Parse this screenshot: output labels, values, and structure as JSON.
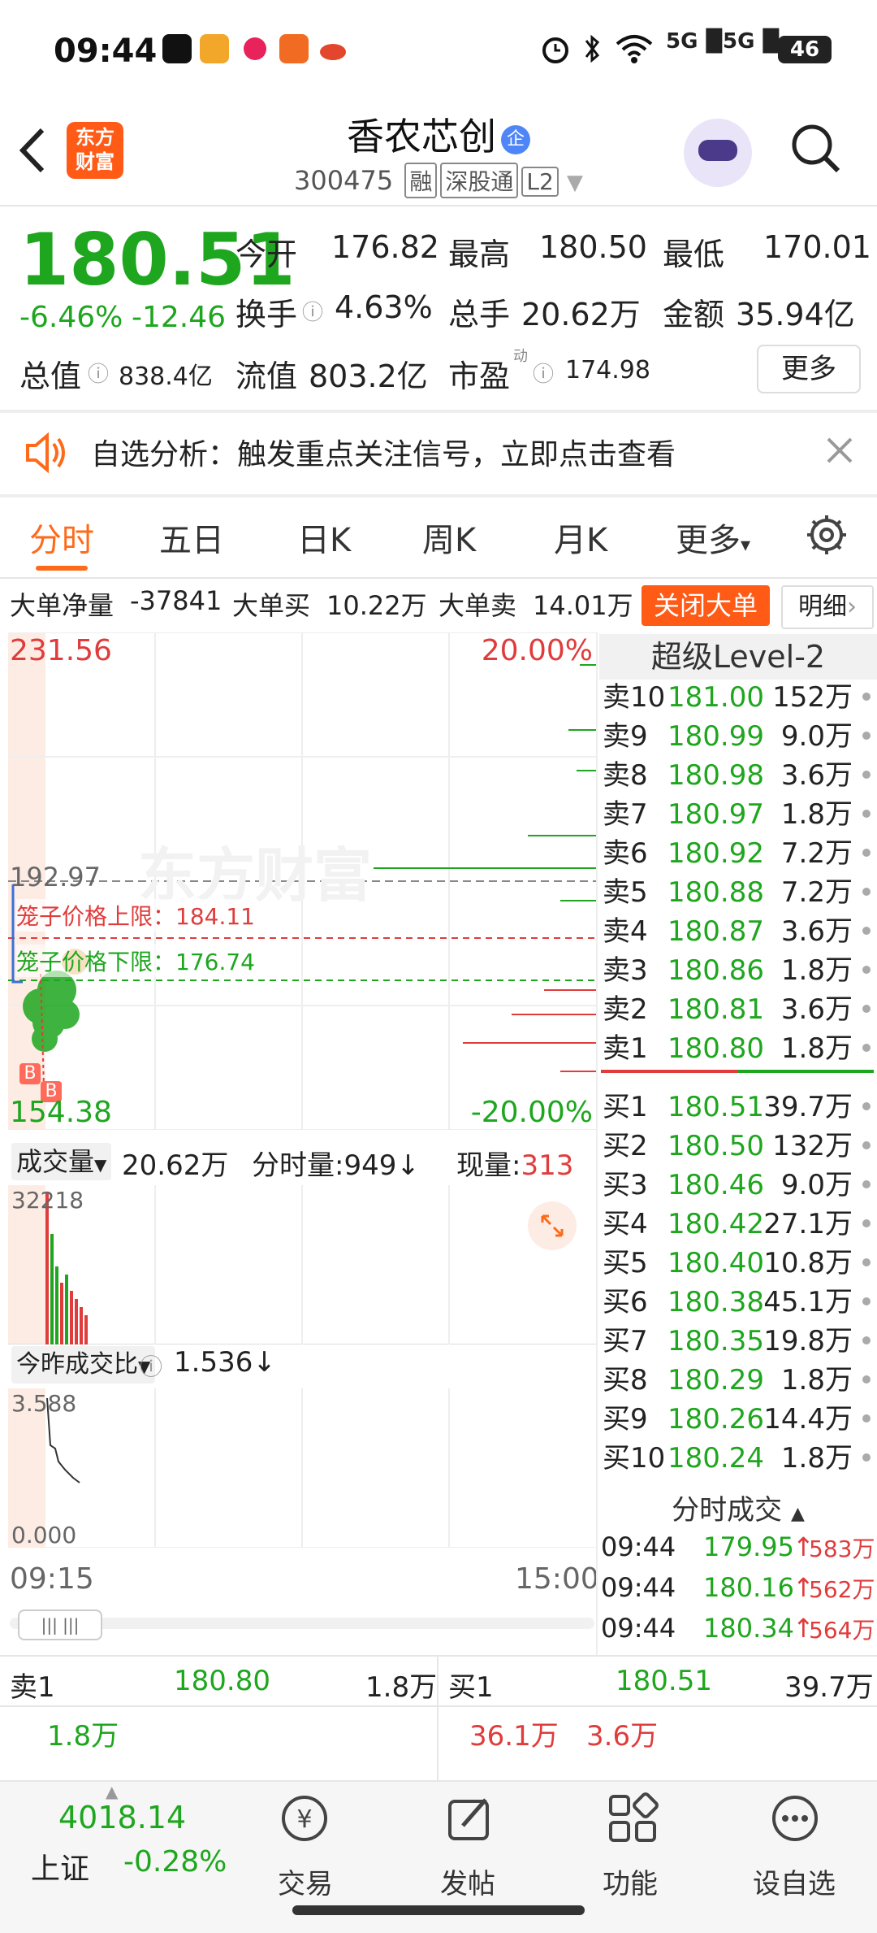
{
  "status_bar": {
    "time": "09:44",
    "network": "5G 5G",
    "battery": "46"
  },
  "header": {
    "back": "<",
    "logo_text": "东方财富",
    "stock_name": "香农芯创",
    "name_badge": "企",
    "code": "300475",
    "tags": [
      "融",
      "深股通",
      "L2"
    ]
  },
  "quote": {
    "price": "180.51",
    "change_pct": "-6.46%",
    "change": "-12.46",
    "open_label": "今开",
    "open": "176.82",
    "high_label": "最高",
    "high": "180.50",
    "low_label": "最低",
    "low": "170.01",
    "turnover_label": "换手",
    "turnover": "4.63%",
    "total_hands_label": "总手",
    "total_hands": "20.62万",
    "amount_label": "金额",
    "amount": "35.94亿",
    "mktcap_label": "总值",
    "mktcap": "838.4亿",
    "float_label": "流值",
    "float_val": "803.2亿",
    "pe_label": "市盈",
    "pe_sup": "动",
    "pe": "174.98",
    "more": "更多"
  },
  "banner": {
    "text": "自选分析：触发重点关注信号，立即点击查看"
  },
  "tabs": [
    "分时",
    "五日",
    "日K",
    "周K",
    "月K",
    "更多"
  ],
  "big_order": {
    "net_label": "大单净量",
    "net": "-37841",
    "buy_label": "大单买",
    "buy": "10.22万",
    "sell_label": "大单卖",
    "sell": "14.01万",
    "close_btn": "关闭大单",
    "detail_btn": "明细"
  },
  "chart": {
    "top_price": "231.56",
    "top_pct": "20.00%",
    "mid_price": "192.97",
    "cage_upper": "笼子价格上限：184.11",
    "cage_lower": "笼子价格下限：176.74",
    "bottom_price": "154.38",
    "bottom_pct": "-20.00%",
    "watermark": "东方财富",
    "markers": [
      "B",
      "B"
    ],
    "volume_label": "成交量",
    "volume": "20.62万",
    "tick_vol_label": "分时量:",
    "tick_vol": "949↓",
    "now_vol_label": "现量:",
    "now_vol": "313",
    "vol_max": "32218",
    "ratio_label": "今昨成交比",
    "ratio": "1.536↓",
    "ratio_max": "3.588",
    "ratio_min": "0.000",
    "time_start": "09:15",
    "time_end": "15:00"
  },
  "order_book": {
    "title": "超级Level-2",
    "sells": [
      {
        "label": "卖10",
        "price": "181.00",
        "vol": "152万"
      },
      {
        "label": "卖9",
        "price": "180.99",
        "vol": "9.0万"
      },
      {
        "label": "卖8",
        "price": "180.98",
        "vol": "3.6万"
      },
      {
        "label": "卖7",
        "price": "180.97",
        "vol": "1.8万"
      },
      {
        "label": "卖6",
        "price": "180.92",
        "vol": "7.2万"
      },
      {
        "label": "卖5",
        "price": "180.88",
        "vol": "7.2万"
      },
      {
        "label": "卖4",
        "price": "180.87",
        "vol": "3.6万"
      },
      {
        "label": "卖3",
        "price": "180.86",
        "vol": "1.8万"
      },
      {
        "label": "卖2",
        "price": "180.81",
        "vol": "3.6万"
      },
      {
        "label": "卖1",
        "price": "180.80",
        "vol": "1.8万"
      }
    ],
    "buys": [
      {
        "label": "买1",
        "price": "180.51",
        "vol": "39.7万"
      },
      {
        "label": "买2",
        "price": "180.50",
        "vol": "132万"
      },
      {
        "label": "买3",
        "price": "180.46",
        "vol": "9.0万"
      },
      {
        "label": "买4",
        "price": "180.42",
        "vol": "27.1万"
      },
      {
        "label": "买5",
        "price": "180.40",
        "vol": "10.8万"
      },
      {
        "label": "买6",
        "price": "180.38",
        "vol": "45.1万"
      },
      {
        "label": "买7",
        "price": "180.35",
        "vol": "19.8万"
      },
      {
        "label": "买8",
        "price": "180.29",
        "vol": "1.8万"
      },
      {
        "label": "买9",
        "price": "180.26",
        "vol": "14.4万"
      },
      {
        "label": "买10",
        "price": "180.24",
        "vol": "1.8万"
      }
    ]
  },
  "trades": {
    "title": "分时成交",
    "rows": [
      {
        "time": "09:44",
        "price": "179.95",
        "vol": "583万"
      },
      {
        "time": "09:44",
        "price": "180.16",
        "vol": "562万"
      },
      {
        "time": "09:44",
        "price": "180.34",
        "vol": "564万"
      }
    ]
  },
  "queue": {
    "sell_label": "卖1",
    "sell_price": "180.80",
    "sell_vol": "1.8万",
    "buy_label": "买1",
    "buy_price": "180.51",
    "buy_vol": "39.7万",
    "sell_q1": "1.8万",
    "buy_q1": "36.1万",
    "buy_q2": "3.6万"
  },
  "bottom_nav": {
    "index_value": "4018.14",
    "index_name": "上证",
    "index_pct": "-0.28%",
    "items": [
      "交易",
      "发帖",
      "功能",
      "设自选"
    ]
  },
  "colors": {
    "up": "#e03c3c",
    "down": "#1ea61e",
    "accent": "#ff6a1a"
  }
}
